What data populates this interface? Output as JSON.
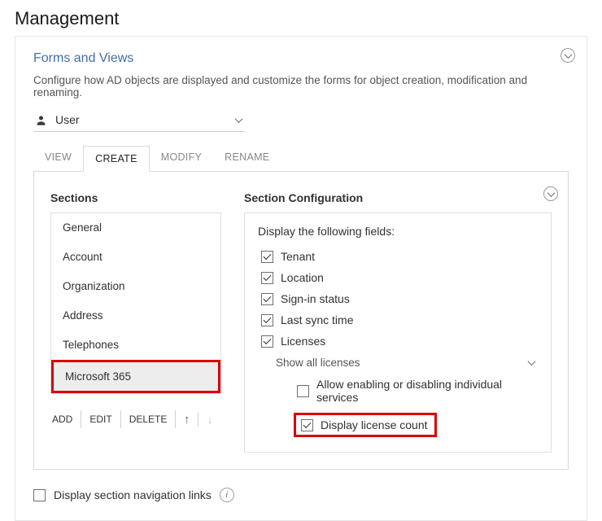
{
  "pageTitle": "Management",
  "panel": {
    "title": "Forms and Views",
    "description": "Configure how AD objects are displayed and customize the forms for object creation, modification and renaming."
  },
  "scope": {
    "selected": "User"
  },
  "tabs": {
    "view": "VIEW",
    "create": "CREATE",
    "modify": "MODIFY",
    "rename": "RENAME",
    "active": "create"
  },
  "sections": {
    "title": "Sections",
    "items": [
      {
        "label": "General"
      },
      {
        "label": "Account"
      },
      {
        "label": "Organization"
      },
      {
        "label": "Address"
      },
      {
        "label": "Telephones"
      },
      {
        "label": "Microsoft 365",
        "selected": true
      }
    ],
    "actions": {
      "add": "ADD",
      "edit": "EDIT",
      "delete": "DELETE"
    }
  },
  "config": {
    "title": "Section Configuration",
    "prompt": "Display the following fields:",
    "fields": {
      "tenant": {
        "label": "Tenant",
        "checked": true
      },
      "location": {
        "label": "Location",
        "checked": true
      },
      "signin": {
        "label": "Sign-in status",
        "checked": true
      },
      "lastsync": {
        "label": "Last sync time",
        "checked": true
      },
      "licenses": {
        "label": "Licenses",
        "checked": true
      },
      "licenseMode": {
        "label": "Show all licenses"
      },
      "allowIndividual": {
        "label": "Allow enabling or disabling individual services",
        "checked": false
      },
      "displayCount": {
        "label": "Display license count",
        "checked": true
      }
    }
  },
  "navLinks": {
    "label": "Display section navigation links",
    "checked": false
  }
}
